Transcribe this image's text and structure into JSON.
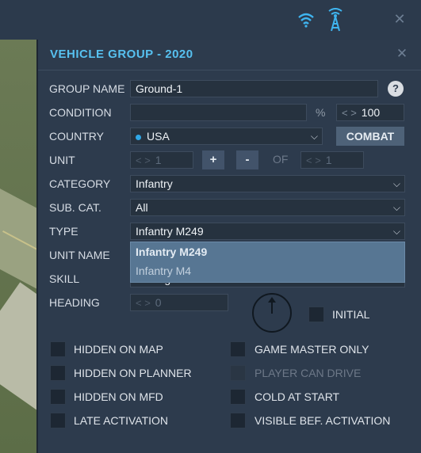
{
  "colors": {
    "accent": "#57c1f0",
    "panel": "#2d3b4d",
    "dropdown": "#577693"
  },
  "topbar": {
    "icons": [
      "wifi-icon",
      "radio-tower-icon",
      "close-icon"
    ]
  },
  "panel": {
    "title": "VEHICLE GROUP - 2020",
    "labels": {
      "group_name": "GROUP NAME",
      "condition": "CONDITION",
      "country": "COUNTRY",
      "unit": "UNIT",
      "category": "CATEGORY",
      "sub_cat": "SUB. CAT.",
      "type": "TYPE",
      "unit_name": "UNIT NAME",
      "skill": "SKILL",
      "heading": "HEADING"
    },
    "group_name_value": "Ground-1",
    "help_label": "?",
    "condition_value": "",
    "condition_unit": "%",
    "condition_pct": "100",
    "country_value": "USA",
    "combat_label": "COMBAT",
    "unit_value": "1",
    "plus_label": "+",
    "minus_label": "-",
    "of_label": "OF",
    "unit_total": "1",
    "category_value": "Infantry",
    "subcat_value": "All",
    "type_value": "Infantry M249",
    "type_options": [
      "Infantry M249",
      "Infantry M4"
    ],
    "skill_value": "Average",
    "heading_value": "0",
    "initial_label": "INITIAL"
  },
  "checkboxes": {
    "left": [
      "HIDDEN ON MAP",
      "HIDDEN ON PLANNER",
      "HIDDEN ON MFD",
      "LATE ACTIVATION"
    ],
    "right": [
      "GAME MASTER ONLY",
      "PLAYER CAN DRIVE",
      "COLD AT START",
      "VISIBLE BEF. ACTIVATION"
    ]
  }
}
